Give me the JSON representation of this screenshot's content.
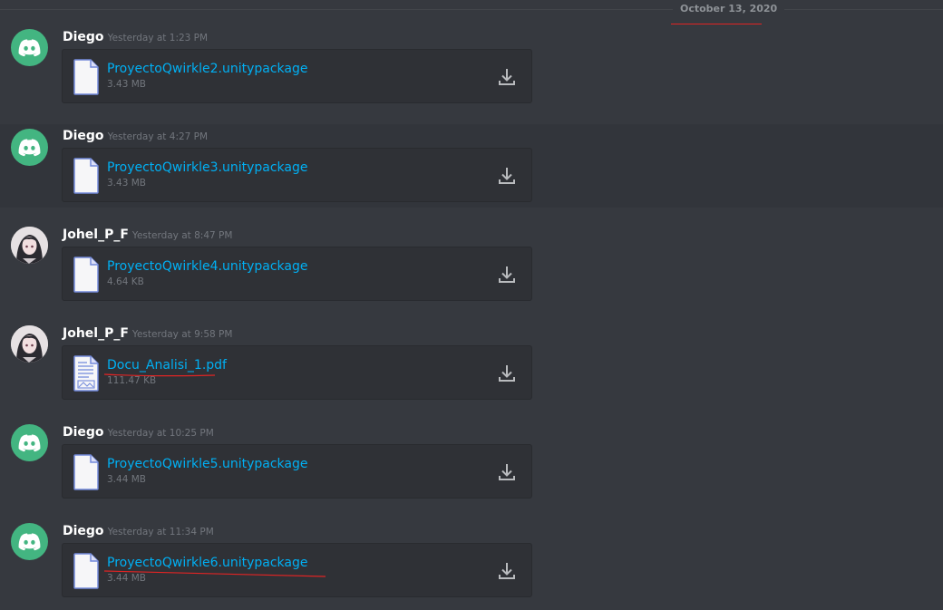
{
  "date_divider": {
    "label": "October 13, 2020"
  },
  "messages": [
    {
      "author": "Diego",
      "timestamp": "Yesterday at 1:23 PM",
      "avatar": "discord-logo",
      "file": {
        "name": "ProyectoQwirkle2.unitypackage",
        "size": "3.43 MB",
        "type": "generic-file-icon"
      }
    },
    {
      "author": "Diego",
      "timestamp": "Yesterday at 4:27 PM",
      "avatar": "discord-logo",
      "file": {
        "name": "ProyectoQwirkle3.unitypackage",
        "size": "3.43 MB",
        "type": "generic-file-icon"
      }
    },
    {
      "author": "Johel_P_F",
      "timestamp": "Yesterday at 8:47 PM",
      "avatar": "anime-portrait",
      "file": {
        "name": "ProyectoQwirkle4.unitypackage",
        "size": "4.64 KB",
        "type": "generic-file-icon"
      }
    },
    {
      "author": "Johel_P_F",
      "timestamp": "Yesterday at 9:58 PM",
      "avatar": "anime-portrait",
      "file": {
        "name": "Docu_Analisi_1.pdf",
        "size": "111.47 KB",
        "type": "document-file-icon"
      }
    },
    {
      "author": "Diego",
      "timestamp": "Yesterday at 10:25 PM",
      "avatar": "discord-logo",
      "file": {
        "name": "ProyectoQwirkle5.unitypackage",
        "size": "3.44 MB",
        "type": "generic-file-icon"
      }
    },
    {
      "author": "Diego",
      "timestamp": "Yesterday at 11:34 PM",
      "avatar": "discord-logo",
      "file": {
        "name": "ProyectoQwirkle6.unitypackage",
        "size": "3.44 MB",
        "type": "generic-file-icon"
      }
    }
  ],
  "colors": {
    "background": "#36393f",
    "attachment_bg": "#2f3136",
    "link": "#00b0f4",
    "discord_green": "#43b581",
    "annotation_red": "#e02424"
  }
}
